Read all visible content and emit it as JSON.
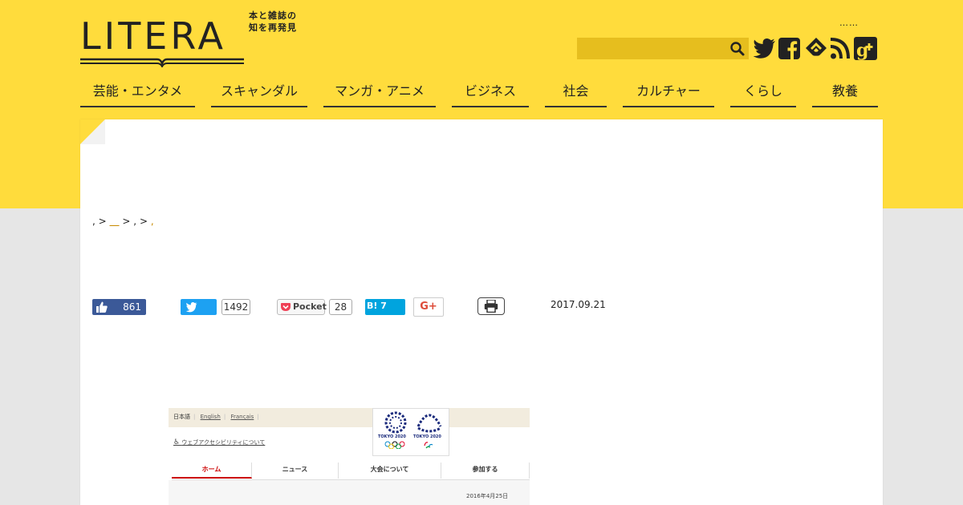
{
  "logo": {
    "wordmark": "LITERA",
    "tagline_line1": "本と雑誌の",
    "tagline_line2": "知を再発見"
  },
  "header": {
    "dots": "……",
    "search_placeholder": ""
  },
  "colors": {
    "brand_yellow": "#ffdc3c",
    "search_bg": "#e6be1e",
    "page_bg": "#e6e6e6",
    "facebook": "#3b5998",
    "twitter": "#1da1f2",
    "hatena": "#00a4de",
    "gplus": "#dd4b39"
  },
  "social_icons": [
    "twitter-icon",
    "facebook-icon",
    "feedly-icon",
    "rss-icon",
    "google-plus-icon"
  ],
  "nav": {
    "items": [
      {
        "label": "芸能・エンタメ"
      },
      {
        "label": "スキャンダル"
      },
      {
        "label": "マンガ・アニメ"
      },
      {
        "label": "ビジネス"
      },
      {
        "label": "社会"
      },
      {
        "label": "カルチャー"
      },
      {
        "label": "くらし"
      },
      {
        "label": "教養"
      }
    ]
  },
  "breadcrumb": {
    "sep1": ",",
    "arrow1": ">",
    "link": "＿",
    "arrow2": ">",
    "sep2": ",",
    "arrow3": ">",
    "sep3": ","
  },
  "share": {
    "facebook_count": "861",
    "twitter_count": "1492",
    "pocket_label": "Pocket",
    "pocket_count": "28",
    "hatena_label": "B! 7",
    "gplus_label": "G+"
  },
  "article": {
    "date": "2017.09.21"
  },
  "embedded_image": {
    "lang_ja": "日本語",
    "lang_en": "English",
    "lang_fr": "Français",
    "accessibility": "ウェブアクセシビリティについて",
    "logo_text_1": "TOKYO 2020",
    "logo_text_2": "TOKYO 2020",
    "tabs": [
      {
        "label": "ホーム"
      },
      {
        "label": "ニュース"
      },
      {
        "label": "大会について"
      },
      {
        "label": "参加する"
      }
    ],
    "date": "2016年4月25日"
  }
}
